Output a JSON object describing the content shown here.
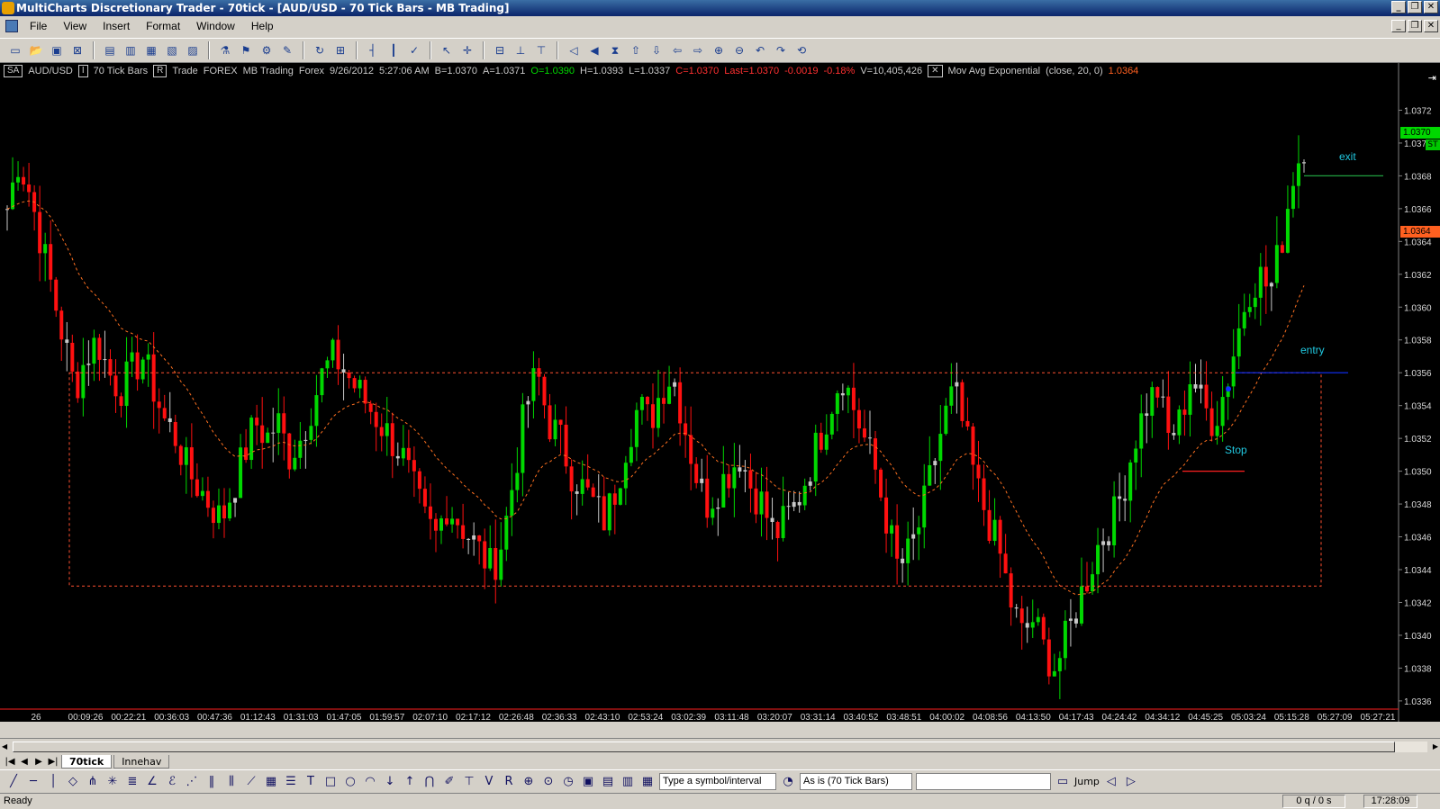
{
  "window": {
    "title": "MultiCharts Discretionary Trader - 70tick - [AUD/USD - 70 Tick Bars - MB Trading]"
  },
  "menu": [
    "File",
    "View",
    "Insert",
    "Format",
    "Window",
    "Help"
  ],
  "status_line": {
    "mode": "SA",
    "symbol": "AUD/USD",
    "interval": "70 Tick Bars",
    "type": "Trade",
    "category": "FOREX",
    "feed": "MB Trading",
    "exchange": "Forex",
    "date": "9/26/2012",
    "time": "5:27:06 AM",
    "bid": "B=1.0370",
    "ask": "A=1.0371",
    "open": "O=1.0390",
    "high": "H=1.0393",
    "low": "L=1.0337",
    "close": "C=1.0370",
    "last": "Last=1.0370",
    "change": "-0.0019",
    "pct": "-0.18%",
    "volume": "V=10,405,426",
    "study": "Mov Avg Exponential",
    "study_params": "(close, 20, 0)",
    "study_value": "1.0364"
  },
  "annotations": {
    "exit": "exit",
    "entry": "entry",
    "stop": "Stop"
  },
  "price_markers": {
    "last": "1.0370",
    "ema": "1.0364",
    "tag": "ST"
  },
  "colors": {
    "up": "#00d800",
    "down": "#ff1010",
    "doji": "#c8c8c8",
    "ema": "#ff7020",
    "range_box": "#ff5030",
    "entry_line": "#1030ff",
    "stop_line": "#ff2020",
    "exit_line": "#20a040",
    "annotation": "#20c8e0"
  },
  "chart_data": {
    "type": "candlestick",
    "symbol": "AUD/USD",
    "interval": "70 Tick Bars",
    "ylim": [
      1.03355,
      1.0374
    ],
    "y_ticks": [
      "1.0372",
      "1.0370",
      "1.0368",
      "1.0366",
      "1.0364",
      "1.0362",
      "1.0360",
      "1.0358",
      "1.0356",
      "1.0354",
      "1.0352",
      "1.0350",
      "1.0348",
      "1.0346",
      "1.0344",
      "1.0342",
      "1.0340",
      "1.0338",
      "1.0336"
    ],
    "x_ticks": [
      "26",
      "00:09:26",
      "00:22:21",
      "00:36:03",
      "00:47:36",
      "01:12:43",
      "01:31:03",
      "01:47:05",
      "01:59:57",
      "02:07:10",
      "02:17:12",
      "02:26:48",
      "02:36:33",
      "02:43:10",
      "02:53:24",
      "03:02:39",
      "03:11:48",
      "03:20:07",
      "03:31:14",
      "03:40:52",
      "03:48:51",
      "04:00:02",
      "04:08:56",
      "04:13:50",
      "04:17:43",
      "04:24:42",
      "04:34:12",
      "04:45:25",
      "05:03:24",
      "05:15:28",
      "05:27:09",
      "05:27:21"
    ],
    "close_path": [
      1.0366,
      1.0369,
      1.0367,
      1.0364,
      1.0361,
      1.0358,
      1.0355,
      1.0357,
      1.0358,
      1.0356,
      1.0355,
      1.0356,
      1.0357,
      1.0355,
      1.0353,
      1.0352,
      1.035,
      1.0349,
      1.0348,
      1.0347,
      1.0349,
      1.0351,
      1.0353,
      1.0352,
      1.0353,
      1.0351,
      1.0352,
      1.0354,
      1.0356,
      1.0357,
      1.0356,
      1.0355,
      1.0354,
      1.0353,
      1.0352,
      1.0351,
      1.0349,
      1.0347,
      1.0346,
      1.0348,
      1.0347,
      1.0346,
      1.0345,
      1.0344,
      1.0346,
      1.035,
      1.0354,
      1.0356,
      1.0353,
      1.0352,
      1.035,
      1.0349,
      1.0348,
      1.0347,
      1.0349,
      1.0352,
      1.0354,
      1.0353,
      1.0355,
      1.0356,
      1.0353,
      1.035,
      1.0348,
      1.0349,
      1.035,
      1.0351,
      1.0349,
      1.0348,
      1.0346,
      1.0347,
      1.0348,
      1.035,
      1.0352,
      1.0354,
      1.0356,
      1.0354,
      1.0352,
      1.035,
      1.0347,
      1.0344,
      1.0345,
      1.0347,
      1.035,
      1.0353,
      1.0355,
      1.0352,
      1.0349,
      1.0347,
      1.0345,
      1.0342,
      1.034,
      1.0341,
      1.0339,
      1.0338,
      1.034,
      1.0342,
      1.0344,
      1.0346,
      1.0347,
      1.0349,
      1.0352,
      1.0354,
      1.0355,
      1.0352,
      1.0353,
      1.0356,
      1.0354,
      1.0353,
      1.0355,
      1.0358,
      1.0361,
      1.0362,
      1.0361,
      1.0364,
      1.0368,
      1.037
    ],
    "ema": {
      "name": "Mov Avg Exponential",
      "params": "(close, 20, 0)",
      "last": 1.0364
    },
    "range_box": {
      "top": 1.0356,
      "bottom": 1.0343
    },
    "entry": 1.0356,
    "stop": 1.035,
    "exit": 1.0368
  },
  "tabs": [
    "70tick",
    "Innehav"
  ],
  "drawbar": {
    "symbol_placeholder": "Type a symbol/interval",
    "interval_combo": "As is (70 Tick Bars)",
    "jump": "Jump"
  },
  "statusbar": {
    "text": "Ready",
    "queue": "0 q / 0 s",
    "clock": "17:28:09"
  }
}
